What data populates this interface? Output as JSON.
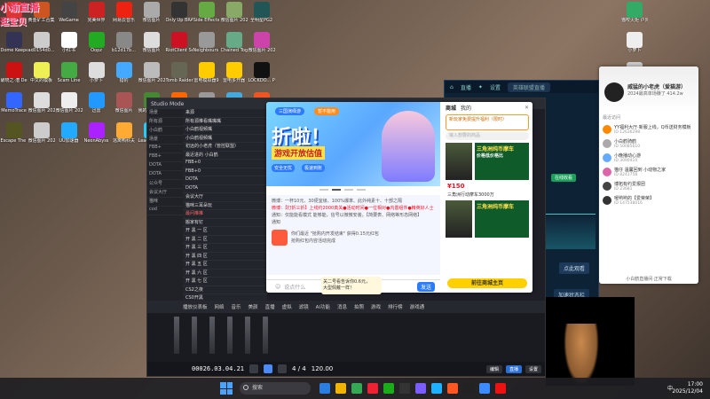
{
  "streamer_overlay": {
    "line1": "小渝直播",
    "line2": "逛宝贝"
  },
  "desktop_icons": [
    {
      "label": "ACE ...",
      "color": "#d33"
    },
    {
      "label": "黄金矿工合集",
      "color": "#c52"
    },
    {
      "label": "WeGame",
      "color": "#444"
    },
    {
      "label": "完美世界",
      "color": "#c22"
    },
    {
      "label": "网易云音乐",
      "color": "#e21"
    },
    {
      "label": "微信图片",
      "color": "#aaa"
    },
    {
      "label": "Only Up BRAINR...",
      "color": "#333"
    },
    {
      "label": "Side Effects",
      "color": "#6a4"
    },
    {
      "label": "微信图片 2025010...",
      "color": "#8a6"
    },
    {
      "label": "全明星PG2",
      "color": "#255"
    },
    {
      "label": "Dome Keeper 更新版",
      "color": "#335"
    },
    {
      "label": "ad0154d0...",
      "color": "#ccc"
    },
    {
      "label": "小红书",
      "color": "#fff"
    },
    {
      "label": "Oopz",
      "color": "#2a2"
    },
    {
      "label": "b12d17b...",
      "color": "#888"
    },
    {
      "label": "微信图片",
      "color": "#ddd"
    },
    {
      "label": "RiotClient Services",
      "color": "#c12"
    },
    {
      "label": "Neighbours back From...",
      "color": "#999"
    },
    {
      "label": "Chained Together",
      "color": "#6a8"
    },
    {
      "label": "微信图片 2025123...",
      "color": "#c4a"
    },
    {
      "label": "破晓之·潜 Demo",
      "color": "#c11"
    },
    {
      "label": "中文的模板",
      "color": "#ee5"
    },
    {
      "label": "Scam Line",
      "color": "#4a4"
    },
    {
      "label": "小萝卜",
      "color": "#ddd"
    },
    {
      "label": "猎豹",
      "color": "#4af"
    },
    {
      "label": "微信图片 2025080...",
      "color": "#bbb"
    },
    {
      "label": "Tomb Raider",
      "color": "#665"
    },
    {
      "label": "雷电模拟器9",
      "color": "#fc0"
    },
    {
      "label": "雷电多开器",
      "color": "#fc0"
    },
    {
      "label": "LOCKDO... Protocol",
      "color": "#111"
    },
    {
      "label": "MemoTrace",
      "color": "#36f"
    },
    {
      "label": "微信图片 20250...",
      "color": "#ddd"
    },
    {
      "label": "微信图片 20250...",
      "color": "#eee"
    },
    {
      "label": "迅雷",
      "color": "#29f"
    },
    {
      "label": "微信图片",
      "color": "#a55"
    },
    {
      "label": "我的世界 The King...",
      "color": "#483"
    },
    {
      "label": "泡泡堂",
      "color": "#f60"
    },
    {
      "label": "微信图片 2025091...",
      "color": "#999"
    },
    {
      "label": "DE",
      "color": "#4ad"
    },
    {
      "label": "微信图片 2025070...",
      "color": "#e52"
    },
    {
      "label": "Escape The Backrooms",
      "color": "#552"
    },
    {
      "label": "微信图片 20250...",
      "color": "#ccc"
    },
    {
      "label": "UU加速器",
      "color": "#2af"
    },
    {
      "label": "NeonAbyss",
      "color": "#a2f"
    },
    {
      "label": "逃离鸭科夫",
      "color": "#fa3"
    },
    {
      "label": "League of Legends",
      "color": "#2cf"
    },
    {
      "label": "Logitech G HUB",
      "color": "#2ad"
    },
    {
      "label": "Everything",
      "color": "#f80"
    },
    {
      "label": "微信图片 2025...",
      "color": "#999"
    },
    {
      "label": "微信图片 2025...",
      "color": "#aaa"
    }
  ],
  "dock_right_icons": [
    {
      "label": "猫咬火炬 户外联盟",
      "color": "#3a6"
    },
    {
      "label": "小萝卜",
      "color": "#eee"
    },
    {
      "label": "微信图片",
      "color": "#ccc"
    }
  ],
  "obs": {
    "title": "Studio Mode",
    "scenes_title": "场景",
    "scenes": [
      "所有源",
      "小白鹤",
      "场景",
      "FBB+",
      "FBB+",
      "DOTA",
      "DOTA",
      "公众号",
      "会议大厅",
      "猫咪",
      "cod"
    ],
    "sources_title": "来源",
    "sources": [
      {
        "label": "所有源推看嘴嘴嘴",
        "red": false
      },
      {
        "label": "小白鹤视频嘴",
        "red": false
      },
      {
        "label": "小白鹤视频嘴",
        "red": false
      },
      {
        "label": "初远的小老虎（管控联盟）",
        "red": false
      },
      {
        "label": "最近进的 小白鹤",
        "red": false
      },
      {
        "label": "FBB+0",
        "red": false
      },
      {
        "label": "FBB+0",
        "red": false
      },
      {
        "label": "DOTA",
        "red": false
      },
      {
        "label": "DOTA",
        "red": false
      },
      {
        "label": "会议大厅",
        "red": false
      },
      {
        "label": "猫咪三耳朵玩",
        "red": false
      },
      {
        "label": "最问推推",
        "red": true
      },
      {
        "label": "搬家有钉",
        "red": false
      },
      {
        "label": "开 黑 一 区",
        "red": false
      },
      {
        "label": "开 黑 二 区",
        "red": false
      },
      {
        "label": "开 黑 三 区",
        "red": false
      },
      {
        "label": "开 黑 四 区",
        "red": false
      },
      {
        "label": "开 黑 五 区",
        "red": false
      },
      {
        "label": "开 黑 六 区",
        "red": false
      },
      {
        "label": "开 黑 七 区",
        "red": false
      },
      {
        "label": "CS2之夜",
        "red": false
      },
      {
        "label": "CS0开黑",
        "red": false
      }
    ],
    "toolbar": [
      "播放仪表板",
      "网络",
      "音乐",
      "美颜",
      "直播",
      "虚拟",
      "滤镜",
      "AI功能",
      "消息",
      "拍照",
      "游戏",
      "排行榜",
      "游戏通"
    ],
    "timecode": "00026.03.04.21",
    "page": "4 / 4",
    "zoom": "120.00",
    "view_tabs": [
      "编辑",
      "直播",
      "设置"
    ],
    "active_view": "直播"
  },
  "store": {
    "banner": {
      "tag_left": "三国演绎游",
      "tag_right": "暂不能用",
      "headline": "折啦！",
      "subheadline": "游戏开放估值",
      "tag3": "安全无忧",
      "tag4": "极速到账"
    },
    "chat_lines": [
      {
        "text": "微博：一杯10元、30便宜级、100%爆率、此外纯素十、十部之隔",
        "red": false
      },
      {
        "text": "微博：【打折三折】上线约2000真关●活动时间●一位相对●内置组件●精英好人士",
        "red": true
      },
      {
        "text": "通知：仅能能看模式 能够能，信号以微微安装，【简要表、网络等形态网络】",
        "red": false
      },
      {
        "text": "通知",
        "red": false
      }
    ],
    "gift_text": "你们最近 \"抢购内开发结束\" 获得0.15元红包",
    "gift_sub": "抢购红包内容活动完成",
    "input_placeholder": "说点什么",
    "send_label": "发送",
    "shop": {
      "tab_active": "商城",
      "tab_2": "我的",
      "promo": "新玩家免费提升福利（限时）",
      "search_placeholder": "输入想要的商品",
      "item1_title": "三角洲纯币摩车",
      "item1_sub": "价格低价格比",
      "price": "¥150",
      "item_name": "三角洲行动摩车3000万",
      "item2_title": "三角洲纯币摩车",
      "cta": "前往商城主页"
    }
  },
  "tip_popup": {
    "line1": "关二号看告诉你0.6元，",
    "line2": "大型佩戴一样！"
  },
  "mainwin": {
    "tabs": [
      "主页",
      "直播",
      "游戏",
      "设置"
    ],
    "search": "英雄联盟直播",
    "badge": "在线收看",
    "view_btn": "点此观看",
    "accel_btn": "加速状态栏"
  },
  "panel": {
    "name": "威猛的小老虎（爱猫游）",
    "stat": "2024最高单场赚了",
    "online": "414.2w",
    "section": "最近访问",
    "users": [
      {
        "name": "YY福利大厅·新服上线，Q币送财务模板",
        "id": "ID 12636298",
        "color": "#f80"
      },
      {
        "name": "小白鹤骑鹤",
        "id": "ID 50085610",
        "color": "#aaa"
      },
      {
        "name": "小晚播动心游",
        "id": "ID 3090410",
        "color": "#6af"
      },
      {
        "name": "猫仔 温馨回到 小动物之家",
        "id": "ID 8241758",
        "color": "#d6a"
      },
      {
        "name": "博拓有约爱报团",
        "id": "ID 23681",
        "color": "#444"
      },
      {
        "name": "嗳哟哟的【爱荣荣】",
        "id": "ID 147538016",
        "color": "#333"
      }
    ],
    "footer": "小白鹤直播间·正常下载"
  },
  "taskbar": {
    "search_placeholder": "搜索",
    "lang": "中",
    "time": "17:00",
    "date": "2025/12/04"
  },
  "colors": {
    "accent": "#2c7bff",
    "obs_bg": "#1e1f26",
    "mainwin_bg": "#0e2236"
  }
}
